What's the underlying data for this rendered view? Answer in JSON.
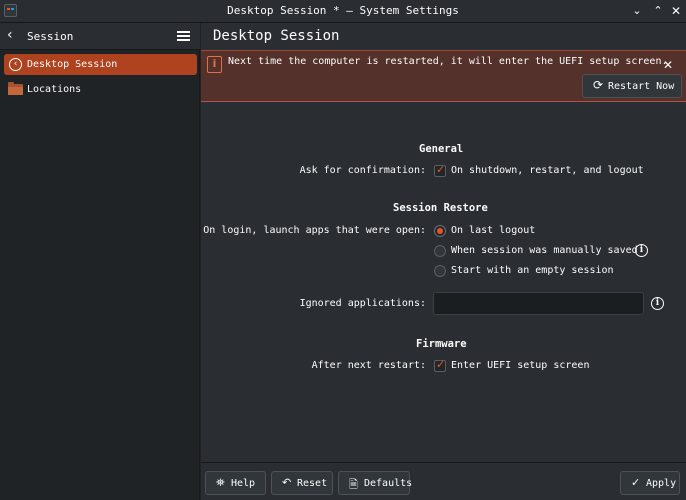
{
  "window": {
    "title": "Desktop Session * — System Settings",
    "controls": [
      "chevron-down",
      "chevron-up",
      "close"
    ]
  },
  "sidebar": {
    "title": "Session",
    "items": [
      {
        "label": "Desktop Session",
        "icon": "session-icon",
        "active": true
      },
      {
        "label": "Locations",
        "icon": "folder-icon",
        "active": false
      }
    ]
  },
  "page": {
    "title": "Desktop Session"
  },
  "banner": {
    "message": "Next time the computer is restarted, it will enter the UEFI setup screen.",
    "button_label": "Restart Now"
  },
  "general": {
    "title": "General",
    "confirm_label": "Ask for confirmation:",
    "confirm_option": "On shutdown, restart, and logout",
    "confirm_checked": true
  },
  "restore": {
    "title": "Session Restore",
    "label": "On login, launch apps that were open:",
    "options": [
      {
        "label": "On last logout",
        "selected": true
      },
      {
        "label": "When session was manually saved",
        "selected": false
      },
      {
        "label": "Start with an empty session",
        "selected": false
      }
    ],
    "ignored_label": "Ignored applications:",
    "ignored_value": ""
  },
  "firmware": {
    "title": "Firmware",
    "label": "After next restart:",
    "option": "Enter UEFI setup screen",
    "checked": true
  },
  "footer": {
    "help": "Help",
    "reset": "Reset",
    "defaults": "Defaults",
    "apply": "Apply"
  },
  "colors": {
    "accent": "#e95420",
    "sidebar_active": "#b0431f",
    "banner_bg": "#54312a"
  }
}
